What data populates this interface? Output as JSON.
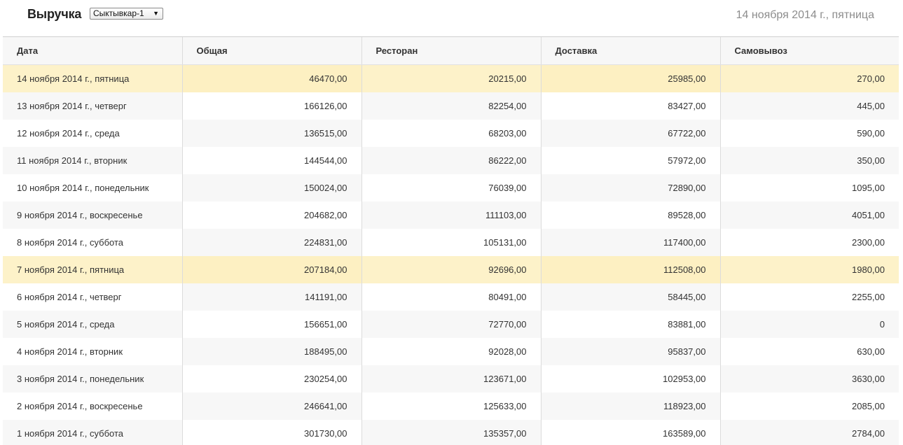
{
  "header": {
    "title": "Выручка",
    "location_select": "Сыктывкар-1",
    "current_date": "14 ноября 2014 г.,  пятница"
  },
  "table": {
    "columns": [
      "Дата",
      "Общая",
      "Ресторан",
      "Доставка",
      "Самовывоз"
    ],
    "rows": [
      {
        "date": "14 ноября 2014 г.,  пятница",
        "total": "46470,00",
        "restaurant": "20215,00",
        "delivery": "25985,00",
        "pickup": "270,00",
        "highlight": true
      },
      {
        "date": "13 ноября 2014 г.,  четверг",
        "total": "166126,00",
        "restaurant": "82254,00",
        "delivery": "83427,00",
        "pickup": "445,00",
        "highlight": false
      },
      {
        "date": "12 ноября 2014 г.,  среда",
        "total": "136515,00",
        "restaurant": "68203,00",
        "delivery": "67722,00",
        "pickup": "590,00",
        "highlight": false
      },
      {
        "date": "11 ноября 2014 г.,  вторник",
        "total": "144544,00",
        "restaurant": "86222,00",
        "delivery": "57972,00",
        "pickup": "350,00",
        "highlight": false
      },
      {
        "date": "10 ноября 2014 г.,  понедельник",
        "total": "150024,00",
        "restaurant": "76039,00",
        "delivery": "72890,00",
        "pickup": "1095,00",
        "highlight": false
      },
      {
        "date": "9 ноября 2014 г.,  воскресенье",
        "total": "204682,00",
        "restaurant": "111103,00",
        "delivery": "89528,00",
        "pickup": "4051,00",
        "highlight": false
      },
      {
        "date": "8 ноября 2014 г.,  суббота",
        "total": "224831,00",
        "restaurant": "105131,00",
        "delivery": "117400,00",
        "pickup": "2300,00",
        "highlight": false
      },
      {
        "date": "7 ноября 2014 г.,  пятница",
        "total": "207184,00",
        "restaurant": "92696,00",
        "delivery": "112508,00",
        "pickup": "1980,00",
        "highlight": true
      },
      {
        "date": "6 ноября 2014 г.,  четверг",
        "total": "141191,00",
        "restaurant": "80491,00",
        "delivery": "58445,00",
        "pickup": "2255,00",
        "highlight": false
      },
      {
        "date": "5 ноября 2014 г.,  среда",
        "total": "156651,00",
        "restaurant": "72770,00",
        "delivery": "83881,00",
        "pickup": "0",
        "highlight": false
      },
      {
        "date": "4 ноября 2014 г.,  вторник",
        "total": "188495,00",
        "restaurant": "92028,00",
        "delivery": "95837,00",
        "pickup": "630,00",
        "highlight": false
      },
      {
        "date": "3 ноября 2014 г.,  понедельник",
        "total": "230254,00",
        "restaurant": "123671,00",
        "delivery": "102953,00",
        "pickup": "3630,00",
        "highlight": false
      },
      {
        "date": "2 ноября 2014 г.,  воскресенье",
        "total": "246641,00",
        "restaurant": "125633,00",
        "delivery": "118923,00",
        "pickup": "2085,00",
        "highlight": false
      },
      {
        "date": "1 ноября 2014 г.,  суббота",
        "total": "301730,00",
        "restaurant": "135357,00",
        "delivery": "163589,00",
        "pickup": "2784,00",
        "highlight": false
      }
    ]
  },
  "colors": {
    "highlight_row": "#fdf2c9",
    "header_bg": "#f7f7f7",
    "muted_text": "#8c8c8c"
  }
}
